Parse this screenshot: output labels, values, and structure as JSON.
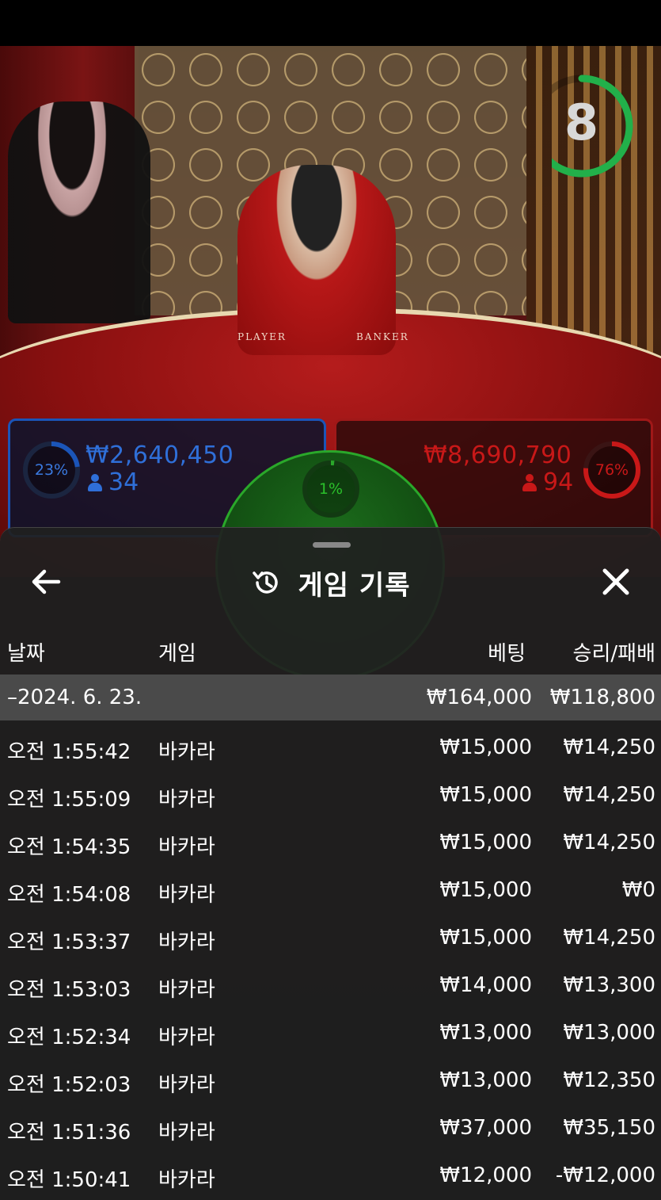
{
  "timer": {
    "seconds": "8",
    "progress": 0.65,
    "color": "#22b04a"
  },
  "table_felt": {
    "player_label": "PLAYER",
    "banker_label": "BANKER"
  },
  "bets": {
    "player": {
      "percent": "23%",
      "percent_value": 0.23,
      "amount": "₩2,640,450",
      "players": "34",
      "color": "#1b55b8"
    },
    "banker": {
      "percent": "76%",
      "percent_value": 0.76,
      "amount": "₩8,690,790",
      "players": "94",
      "color": "#c81818"
    },
    "tie": {
      "percent": "1%",
      "percent_value": 0.01,
      "color": "#2aa82a"
    }
  },
  "history": {
    "title": "게임 기록",
    "back_icon": "arrow-left-icon",
    "close_icon": "close-icon",
    "title_icon": "history-icon",
    "columns": {
      "date": "날짜",
      "game": "게임",
      "bet": "베팅",
      "result": "승리/패배"
    },
    "date_group": {
      "date": "–2024. 6. 23.",
      "bet_total": "₩164,000",
      "result_total": "₩118,800"
    },
    "rows": [
      {
        "time": "오전 1:55:42",
        "game": "바카라",
        "bet": "₩15,000",
        "result": "₩14,250"
      },
      {
        "time": "오전 1:55:09",
        "game": "바카라",
        "bet": "₩15,000",
        "result": "₩14,250"
      },
      {
        "time": "오전 1:54:35",
        "game": "바카라",
        "bet": "₩15,000",
        "result": "₩14,250"
      },
      {
        "time": "오전 1:54:08",
        "game": "바카라",
        "bet": "₩15,000",
        "result": "₩0"
      },
      {
        "time": "오전 1:53:37",
        "game": "바카라",
        "bet": "₩15,000",
        "result": "₩14,250"
      },
      {
        "time": "오전 1:53:03",
        "game": "바카라",
        "bet": "₩14,000",
        "result": "₩13,300"
      },
      {
        "time": "오전 1:52:34",
        "game": "바카라",
        "bet": "₩13,000",
        "result": "₩13,000"
      },
      {
        "time": "오전 1:52:03",
        "game": "바카라",
        "bet": "₩13,000",
        "result": "₩12,350"
      },
      {
        "time": "오전 1:51:36",
        "game": "바카라",
        "bet": "₩37,000",
        "result": "₩35,150"
      },
      {
        "time": "오전 1:50:41",
        "game": "바카라",
        "bet": "₩12,000",
        "result": "-₩12,000"
      }
    ]
  }
}
